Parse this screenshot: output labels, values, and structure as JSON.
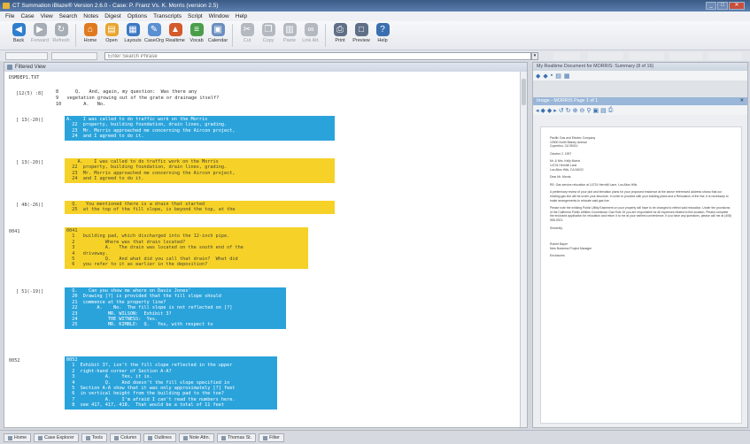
{
  "window": {
    "title": "CT Summation iBlaze® Version 2.6.0 - Case: P. Franz Vs. K. Morris (version 2.5)"
  },
  "menu": [
    "File",
    "Case",
    "View",
    "Search",
    "Notes",
    "Digest",
    "Options",
    "Transcripts",
    "Script",
    "Window",
    "Help"
  ],
  "toolbar": [
    {
      "label": "Back",
      "icon": "back-arrow-icon",
      "color": "#2f7fcf",
      "glyph": "◀",
      "dim": false
    },
    {
      "label": "Forward",
      "icon": "forward-arrow-icon",
      "color": "#a7adb5",
      "glyph": "▶",
      "dim": true
    },
    {
      "label": "Refresh",
      "icon": "refresh-icon",
      "color": "#a7adb5",
      "glyph": "↻",
      "dim": true
    },
    {
      "label": "Home",
      "icon": "home-icon",
      "color": "#e07a1f",
      "glyph": "⌂",
      "dim": false
    },
    {
      "label": "Open",
      "icon": "open-folder-icon",
      "color": "#e9a52e",
      "glyph": "▤",
      "dim": false
    },
    {
      "label": "Layouts",
      "icon": "layouts-icon",
      "color": "#3c78c4",
      "glyph": "▦",
      "dim": false
    },
    {
      "label": "CaseOrg",
      "icon": "case-organizer-icon",
      "color": "#5a8fd1",
      "glyph": "✎",
      "dim": false
    },
    {
      "label": "Realtime",
      "icon": "realtime-icon",
      "color": "#d45a2a",
      "glyph": "▲",
      "dim": false
    },
    {
      "label": "Vocab",
      "icon": "vocab-icon",
      "color": "#4a9e4a",
      "glyph": "≡",
      "dim": false
    },
    {
      "label": "Calendar",
      "icon": "calendar-icon",
      "color": "#6b8fbf",
      "glyph": "▣",
      "dim": false
    },
    {
      "label": "Cut",
      "icon": "scissors-icon",
      "color": "#b4b9c0",
      "glyph": "✂",
      "dim": true
    },
    {
      "label": "Copy",
      "icon": "copy-icon",
      "color": "#b4b9c0",
      "glyph": "❐",
      "dim": true
    },
    {
      "label": "Paste",
      "icon": "paste-icon",
      "color": "#b4b9c0",
      "glyph": "▥",
      "dim": true
    },
    {
      "label": "Link Att.",
      "icon": "link-attachment-icon",
      "color": "#b4b9c0",
      "glyph": "∞",
      "dim": true
    },
    {
      "label": "Print",
      "icon": "printer-icon",
      "color": "#5f6f86",
      "glyph": "⎙",
      "dim": false
    },
    {
      "label": "Preview",
      "icon": "preview-icon",
      "color": "#5f6f86",
      "glyph": "□",
      "dim": false
    },
    {
      "label": "Help",
      "icon": "help-icon",
      "color": "#3a6fb0",
      "glyph": "?",
      "dim": false
    }
  ],
  "search": {
    "placeholder": "Enter Search Phrase"
  },
  "left_pane": {
    "title": "Filtered View",
    "file": "DSMDEP1.TXT",
    "intro_cite": "[12(5) :8]",
    "intro_lines": [
      "8      Q.   And, again, my question:  Was there any",
      "9   vegetation growing out of the grate or drainage itself?",
      "10        A.   No."
    ],
    "blocks": [
      {
        "cite": "[ 13(-20)]",
        "color": "blue",
        "lines": [
          "A.    I was called to do traffic work on the Morris",
          "  22  property, building foundation, drain lines, grading.",
          "  23  Mr. Morris approached me concerning the Aircon project,",
          "  24  and I agreed to do it."
        ]
      },
      {
        "cite": "[ 13(-20)]",
        "color": "yellow",
        "lines": [
          "    A.    I was called to do traffic work on the Morris",
          "  22  property, building foundation, drain lines, grading.",
          "  23  Mr. Morris approached me concerning the Aircon project,",
          "  24  and I agreed to do it."
        ]
      },
      {
        "cite": "[ 48(-26)]",
        "color": "yellow",
        "lines": [
          "  Q.   You mentioned there is a drain that started",
          "  25  at the top of the fill slope, is beyond the top, at the"
        ]
      },
      {
        "cite": "0041",
        "color": "yellow",
        "lines": [
          "0041",
          "  1   building pad, which discharged into the 12-inch pipe.",
          "  2           Where was that drain located?",
          "  3           A.   The drain was located on the south end of the",
          "  4   driveway.",
          "  5           Q.   And what did you call that drain?  What did",
          "  6   you refer to it as earlier in the deposition?"
        ]
      },
      {
        "cite": "[ 51(-19)]",
        "color": "blue",
        "lines": [
          "  Q.    Can you show me where on Davis Jones'",
          "  20  Drawing [?] is provided that the fill slope should",
          "  21  commence at the property line?",
          "  22       A.    No.  The fill slope is not reflected on [?]",
          "  23           MR. WILSON:  Exhibit 3?",
          "  24           THE WITNESS:  Yes.",
          "  25           MR. KIMBLE:  Q.   Yes, with respect to"
        ]
      },
      {
        "cite": "0052",
        "color": "blue",
        "lines": [
          "0052",
          "  1  Exhibit 3?, isn't the fill slope reflected in the upper",
          "  2  right-hand corner of Section A-A?",
          "  3           A.    Yes, it is.",
          "  4           Q.    And doesn't the fill slope specified in",
          "  5  Section A-A show that it was only approximately [?] feet",
          "  6  in vertical height from the building pad to the toe?",
          "  7           A.    I'm afraid I can't read the numbers here.",
          "  8  see 417, 417, 418.  That would be a total of 11 feet"
        ]
      }
    ]
  },
  "right_pane": {
    "summary_title": "My Realtime Document for MORRIS: Summary (8 of 16)",
    "image_title": "Image - MORRIS Page 1 of 1",
    "letter": {
      "company": [
        "Pacific Gas and Electric Company",
        "10900 North Blaney Avenue",
        "Cupertino, CA 95014"
      ],
      "date": "October 2, 1997",
      "addressee": [
        "Mr. & Mrs. Kelly Morris",
        "14724 Hernhill Lane",
        "Los Altos Hills, CA 94022"
      ],
      "salutation": "Dear Mr. Morris:",
      "re": "RE: Gas service relocation at 14724 Hernhill Lane, Los Altos Hills",
      "body": [
        "A preliminary review of your plot and elevation plans for your proposed residence at the above referenced address shows that our existing gas line will be under your structure. In order to proceed with your building plans and a Relocation of the line, it is necessary to make arrangements to relocate said gas line.",
        "Please note the existing Public Utility Easement on your property will have to be changed to reflect said relocation. Under the provisions of the California Public Utilities Commission Gas Rule 15 you are responsible for all expenses related to this location. Please complete the enclosed application for relocation and return it to me at your earliest convenience. If you have any questions, please call me at (408) 555-0921."
      ],
      "closing": "Sincerely,",
      "signer": [
        "Robert Bayer",
        "New Business Project Manager"
      ],
      "enclosure": "Enclosures"
    }
  },
  "statusbar": [
    "Home",
    "Case Explorer",
    "Tools",
    "Column",
    "Outlines",
    "Note Attn.",
    "Thomas St.",
    "Filter"
  ]
}
